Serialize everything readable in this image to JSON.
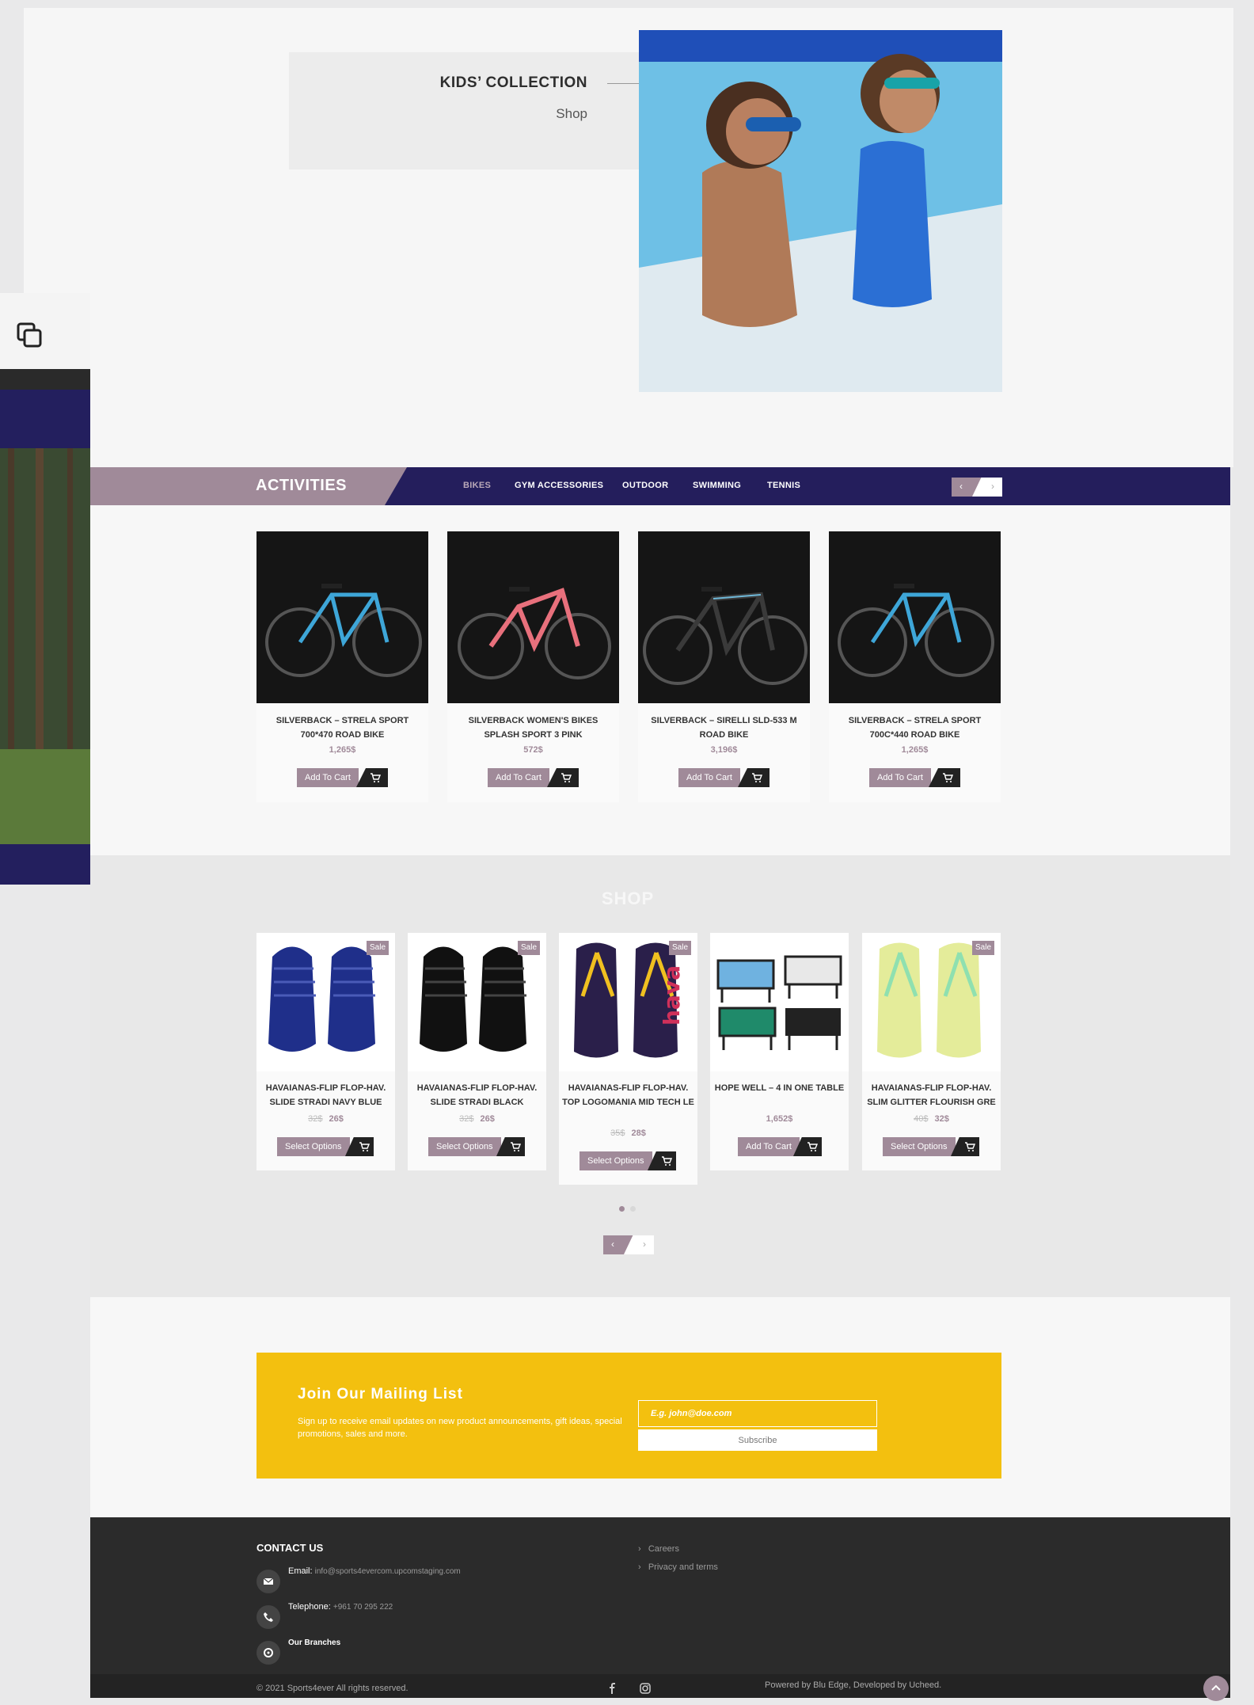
{
  "colors": {
    "navy": "#241e5c",
    "mauve": "#a08a99",
    "yellow": "#f3c00f",
    "dark": "#2b2b2b"
  },
  "hero": {
    "title": "KIDS’ COLLECTION",
    "link": "Shop"
  },
  "activities": {
    "title": "ACTIVITIES",
    "tabs": [
      {
        "label": "BIKES",
        "active": true
      },
      {
        "label": "GYM ACCESSORIES",
        "active": false
      },
      {
        "label": "OUTDOOR",
        "active": false
      },
      {
        "label": "SWIMMING",
        "active": false
      },
      {
        "label": "TENNIS",
        "active": false
      }
    ],
    "prev_icon": "chevron-left-icon",
    "next_icon": "chevron-right-icon",
    "products": [
      {
        "name": "SILVERBACK – STRELA SPORT 700*470 ROAD BIKE",
        "price": "1,265$",
        "button": "Add To Cart",
        "frame_color": "#3ea6d8"
      },
      {
        "name": "SILVERBACK WOMEN'S BIKES SPLASH SPORT 3 PINK",
        "price": "572$",
        "button": "Add To Cart",
        "frame_color": "#e8707c"
      },
      {
        "name": "SILVERBACK – SIRELLI SLD-533 M ROAD BIKE",
        "price": "3,196$",
        "button": "Add To Cart",
        "frame_color": "#6fb8d8"
      },
      {
        "name": "SILVERBACK – STRELA SPORT 700C*440 ROAD BIKE",
        "price": "1,265$",
        "button": "Add To Cart",
        "frame_color": "#3ea6d8"
      }
    ]
  },
  "shop": {
    "title": "SHOP",
    "products": [
      {
        "name": "HAVAIANAS-FLIP FLOP-HAV. SLIDE STRADI NAVY BLUE",
        "old_price": "32$",
        "price": "26$",
        "button": "Select Options",
        "sale": "Sale"
      },
      {
        "name": "HAVAIANAS-FLIP FLOP-HAV. SLIDE STRADI BLACK",
        "old_price": "32$",
        "price": "26$",
        "button": "Select Options",
        "sale": "Sale"
      },
      {
        "name": "HAVAIANAS-FLIP FLOP-HAV. TOP LOGOMANIA MID TECH LE",
        "old_price": "35$",
        "price": "28$",
        "button": "Select Options",
        "sale": "Sale"
      },
      {
        "name": "HOPE WELL – 4 IN ONE TABLE",
        "old_price": "",
        "price": "1,652$",
        "button": "Add To Cart",
        "sale": ""
      },
      {
        "name": "HAVAIANAS-FLIP FLOP-HAV. SLIM GLITTER FLOURISH GRE",
        "old_price": "40$",
        "price": "32$",
        "button": "Select Options",
        "sale": "Sale"
      }
    ]
  },
  "mailing": {
    "title": "Join Our Mailing List",
    "text": "Sign up to receive email updates on new product announcements, gift ideas, special promotions, sales and more.",
    "placeholder": "E.g. john@doe.com",
    "button": "Subscribe"
  },
  "footer": {
    "contact_title": "CONTACT US",
    "email_label": "Email:",
    "email": "info@sports4evercom.upcomstaging.com",
    "phone_label": "Telephone:",
    "phone": "+961 70 295 222",
    "branches": "Our Branches",
    "links": [
      "Careers",
      "Privacy and terms"
    ],
    "copyright": "© 2021 Sports4ever All rights reserved.",
    "powered": "Powered by Blu Edge, Developed by Ucheed."
  }
}
